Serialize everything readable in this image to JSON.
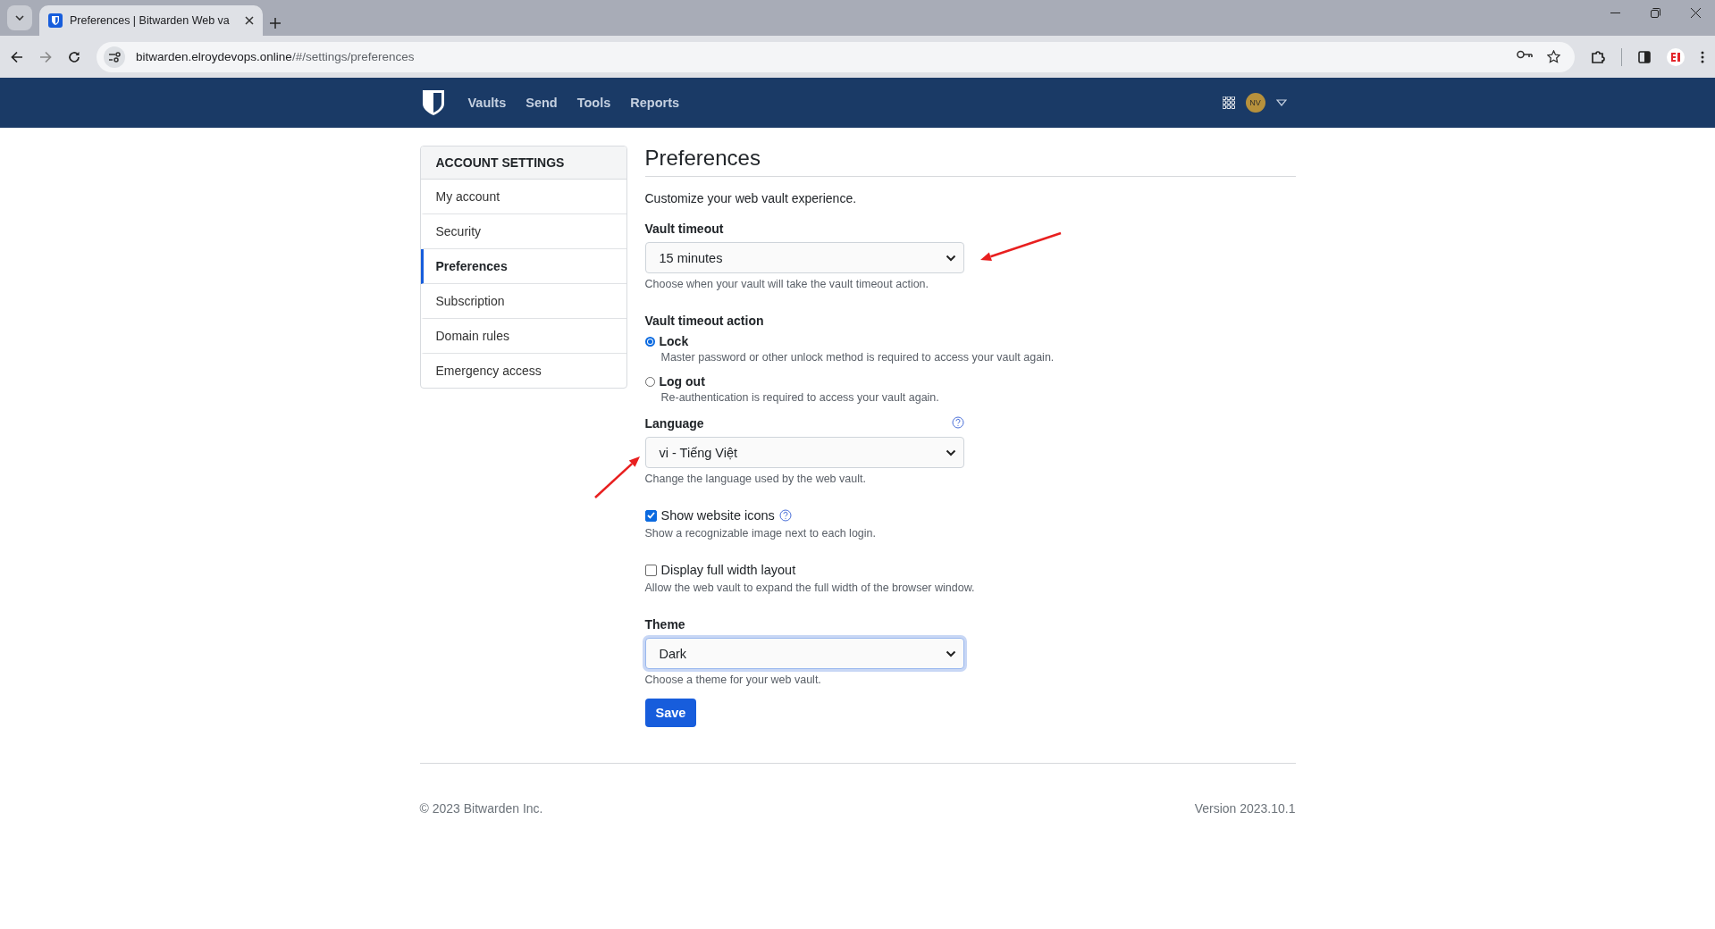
{
  "browser": {
    "tab_title": "Preferences | Bitwarden Web va",
    "address": {
      "host": "bitwarden.elroydevops.online",
      "path": "/#/settings/preferences"
    }
  },
  "nav": {
    "items": [
      {
        "label": "Vaults"
      },
      {
        "label": "Send"
      },
      {
        "label": "Tools"
      },
      {
        "label": "Reports"
      }
    ],
    "avatar_initials": "NV"
  },
  "sidebar": {
    "heading": "ACCOUNT SETTINGS",
    "items": [
      {
        "label": "My account",
        "selected": false
      },
      {
        "label": "Security",
        "selected": false
      },
      {
        "label": "Preferences",
        "selected": true
      },
      {
        "label": "Subscription",
        "selected": false
      },
      {
        "label": "Domain rules",
        "selected": false
      },
      {
        "label": "Emergency access",
        "selected": false
      }
    ]
  },
  "page": {
    "title": "Preferences",
    "description": "Customize your web vault experience."
  },
  "vault_timeout": {
    "label": "Vault timeout",
    "value": "15 minutes",
    "hint": "Choose when your vault will take the vault timeout action.",
    "focused": false
  },
  "timeout_action": {
    "label": "Vault timeout action",
    "options": [
      {
        "label": "Lock",
        "description": "Master password or other unlock method is required to access your vault again.",
        "selected": true
      },
      {
        "label": "Log out",
        "description": "Re-authentication is required to access your vault again.",
        "selected": false
      }
    ]
  },
  "language": {
    "label": "Language",
    "value": "vi - Tiếng Việt",
    "hint": "Change the language used by the web vault.",
    "focused": false
  },
  "options": [
    {
      "label": "Show website icons",
      "hint": "Show a recognizable image next to each login.",
      "checked": true,
      "help": true
    },
    {
      "label": "Display full width layout",
      "hint": "Allow the web vault to expand the full width of the browser window.",
      "checked": false,
      "help": false
    }
  ],
  "theme": {
    "label": "Theme",
    "value": "Dark",
    "hint": "Choose a theme for your web vault.",
    "focused": true
  },
  "save_button": "Save",
  "footer": {
    "copyright": "© 2023 Bitwarden Inc.",
    "version": "Version 2023.10.1"
  }
}
